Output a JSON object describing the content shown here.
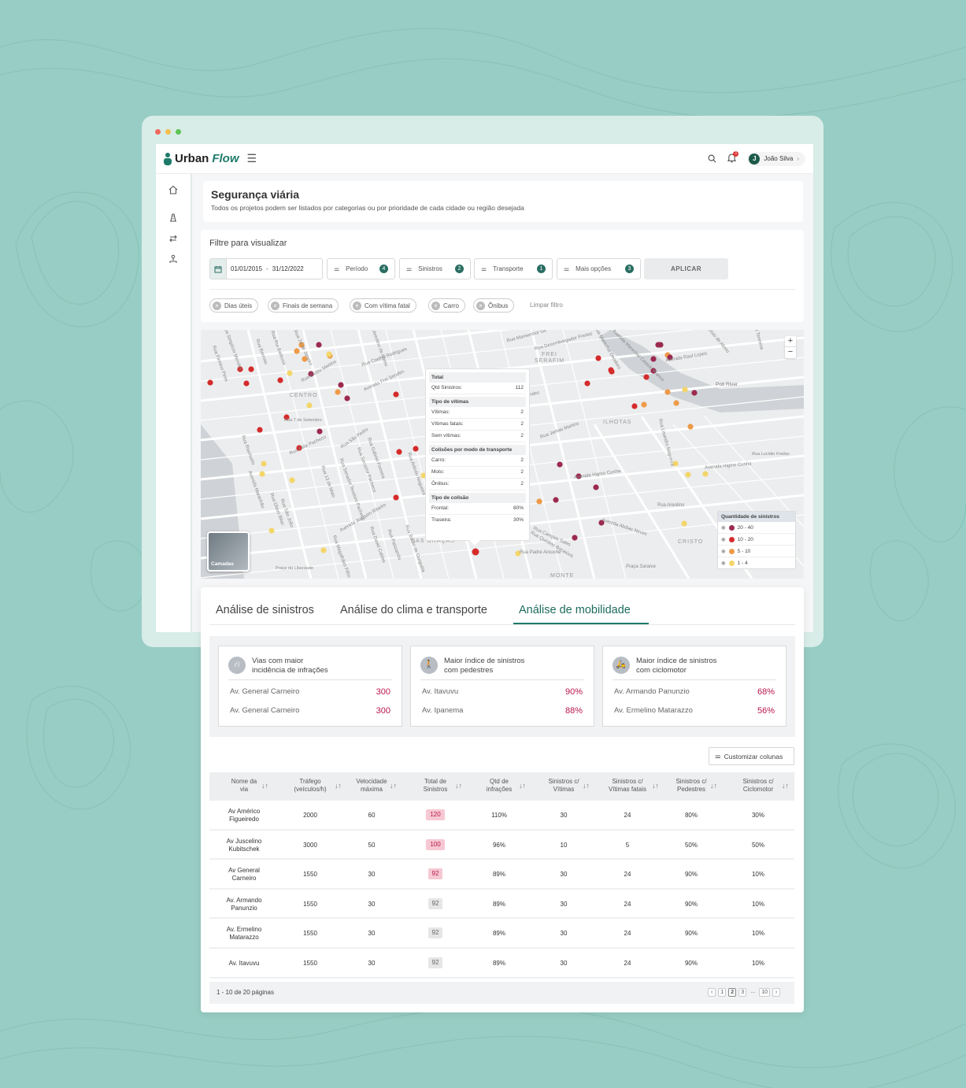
{
  "brand": {
    "name_main": "Urban",
    "name_accent": "Flow"
  },
  "user": {
    "initial": "J",
    "name": "João Silva",
    "notification_count": "1"
  },
  "page": {
    "title": "Segurança viária",
    "subtitle": "Todos os projetos podem ser listados por categorias ou por prioridade de cada cidade ou região desejada"
  },
  "filters": {
    "heading": "Filtre para visualizar",
    "date_start": "01/01/2015",
    "date_sep": "-",
    "date_end": "31/12/2022",
    "buttons": [
      {
        "label": "Período",
        "count": "4"
      },
      {
        "label": "Sinistros",
        "count": "2"
      },
      {
        "label": "Transporte",
        "count": "1"
      },
      {
        "label": "Mais opções",
        "count": "3"
      }
    ],
    "apply_label": "APLICAR",
    "chips": [
      "Dias úteis",
      "Finais de semana",
      "Com vítima fatal",
      "Carro",
      "Ônibus"
    ],
    "clear_label": "Limpar filtro"
  },
  "map": {
    "labels": [
      "CENTRO",
      "FREI SERAFIM",
      "ILHOTAS",
      "DAS GRAÇAS",
      "CRISTO",
      "MONTE",
      "Avenida Frei Serafim",
      "Avenida Higino Cunha",
      "Avenida Higino Cunha",
      "Avenida Joaquim Ribeiro",
      "Rua São Pedro",
      "Rua Félix Pacheco",
      "Poti River",
      "Avenida Abdias Neves",
      "Rua Jarbas Martins",
      "Avenida Raul Lopes",
      "Rua Coelho Rodrigues",
      "Rua Areolino de Abreu",
      "Rua Desembargador Freitas",
      "Rua Barroso",
      "Rua Álvaro Mendes",
      "Rua Lisandro Nogueira",
      "Rua Gabriel Ferreira",
      "Rua Senador Teodoro Pacheco",
      "Rua Arlindo Nogueira",
      "Rua Simplício Mendes",
      "Rua Firmino Pires",
      "Rua Elizeu Martins",
      "Avenida Maranhão",
      "Rua Riachuelo",
      "Rua Quintino Bocaiúva",
      "Rua 7 de Setembro",
      "Rua Senador Pacheco",
      "Rua Paissandu",
      "Rua 24 de Janeiro",
      "Rua Rui Barbosa",
      "Rua 13 de Maio",
      "Rua David Caldas",
      "Praça da Liberdade",
      "Rua Olavo Bilac",
      "Rua São João",
      "Rua Magalhães Filho",
      "Rua Barão de Gurguéia",
      "Praça Saraiva",
      "Rua Monsenhor Gil",
      "Rua Marechal Deodoro",
      "Rua Teresina",
      "Rua Lucídio Freitas",
      "Rua Anísio de Abreu",
      "Avenida Marechal Castelo Branco",
      "Rua Padre Arouche",
      "Rua Areolino",
      "Rua Campos Sales"
    ],
    "tooltip": {
      "total_label": "Total",
      "total_rows": [
        {
          "label": "Qtd Sinistros:",
          "value": "112"
        }
      ],
      "victims_label": "Tipo de vítimas",
      "victims_rows": [
        {
          "label": "Vítimas:",
          "value": "2"
        },
        {
          "label": "Vítimas fatais:",
          "value": "2"
        },
        {
          "label": "Sem vítimas:",
          "value": "2"
        }
      ],
      "transport_label": "Colisões por modo de transporte",
      "transport_rows": [
        {
          "label": "Carro:",
          "value": "2"
        },
        {
          "label": "Moto:",
          "value": "2"
        },
        {
          "label": "Ônibus:",
          "value": "2"
        }
      ],
      "collision_label": "Tipo de colisão",
      "collision_rows": [
        {
          "label": "Frontal:",
          "value": "80%"
        },
        {
          "label": "Traseira:",
          "value": "30%"
        }
      ]
    },
    "legend": {
      "title": "Quantidade de sinistros",
      "items": [
        {
          "label": "20 - 40",
          "color": "#9c2a4f"
        },
        {
          "label": "10 - 20",
          "color": "#d52b2b"
        },
        {
          "label": "5 - 10",
          "color": "#ee9a48"
        },
        {
          "label": "1 - 4",
          "color": "#f3d56a"
        }
      ]
    },
    "layers_label": "Camadas",
    "zoom_in": "+",
    "zoom_out": "−"
  },
  "tabs": [
    "Análise de sinistros",
    "Análise do clima e transporte",
    "Análise de mobilidade"
  ],
  "cards": [
    {
      "icon": "road-icon",
      "title1": "Vias com maior",
      "title2": "incidência de infrações",
      "rows": [
        {
          "name": "Av. General Carneiro",
          "value": "300"
        },
        {
          "name": "Av. General Carneiro",
          "value": "300"
        }
      ]
    },
    {
      "icon": "pedestrian-icon",
      "title1": "Maior índice de sinistros",
      "title2": "com pedestres",
      "rows": [
        {
          "name": "Av. Itavuvu",
          "value": "90%"
        },
        {
          "name": "Av. Ipanema",
          "value": "88%"
        }
      ]
    },
    {
      "icon": "motorcycle-icon",
      "title1": "Maior índice de sinistros",
      "title2": "com ciclomotor",
      "rows": [
        {
          "name": "Av. Armando Panunzio",
          "value": "68%"
        },
        {
          "name": "Av. Ermelino Matarazzo",
          "value": "56%"
        }
      ]
    }
  ],
  "customize_label": "Customizar colunas",
  "table": {
    "headers": [
      [
        "Nome da",
        "via"
      ],
      [
        "Tráfego",
        "(veículos/h)"
      ],
      [
        "Velocidade",
        "máxima"
      ],
      [
        "Total de",
        "Sinistros"
      ],
      [
        "Qtd de",
        "infrações"
      ],
      [
        "Sinistros c/",
        "Vítimas"
      ],
      [
        "Sinistros c/",
        "Vítimas fatais"
      ],
      [
        "Sinistros c/",
        "Pedestres"
      ],
      [
        "Sinistros c/",
        "Ciclomotor"
      ]
    ],
    "rows": [
      {
        "name1": "Av Américo",
        "name2": "Figueiredo",
        "traffic": "2000",
        "speed": "60",
        "total": "120",
        "level": "high",
        "infr": "110%",
        "vit": "30",
        "fat": "24",
        "ped": "80%",
        "cic": "30%"
      },
      {
        "name1": "Av Juscelino",
        "name2": "Kubitschek",
        "traffic": "3000",
        "speed": "50",
        "total": "100",
        "level": "high",
        "infr": "96%",
        "vit": "10",
        "fat": "5",
        "ped": "50%",
        "cic": "50%"
      },
      {
        "name1": "Av General",
        "name2": "Carneiro",
        "traffic": "1550",
        "speed": "30",
        "total": "92",
        "level": "mid",
        "infr": "89%",
        "vit": "30",
        "fat": "24",
        "ped": "90%",
        "cic": "10%"
      },
      {
        "name1": "Av. Armando",
        "name2": "Panunzio",
        "traffic": "1550",
        "speed": "30",
        "total": "92",
        "level": "low",
        "infr": "89%",
        "vit": "30",
        "fat": "24",
        "ped": "90%",
        "cic": "10%"
      },
      {
        "name1": "Av. Ermelino",
        "name2": "Matarazzo",
        "traffic": "1550",
        "speed": "30",
        "total": "92",
        "level": "low",
        "infr": "89%",
        "vit": "30",
        "fat": "24",
        "ped": "90%",
        "cic": "10%"
      },
      {
        "name1": "Av. Itavuvu",
        "name2": "",
        "traffic": "1550",
        "speed": "30",
        "total": "92",
        "level": "low",
        "infr": "89%",
        "vit": "30",
        "fat": "24",
        "ped": "90%",
        "cic": "10%"
      }
    ],
    "footer": "1 - 10 de 20 páginas",
    "pages": [
      "‹",
      "1",
      "2",
      "3",
      "...",
      "10",
      "›"
    ]
  },
  "colors": {
    "accent": "#1d7a6a",
    "highlight": "#b8174d",
    "bg": "#97cdc4"
  }
}
